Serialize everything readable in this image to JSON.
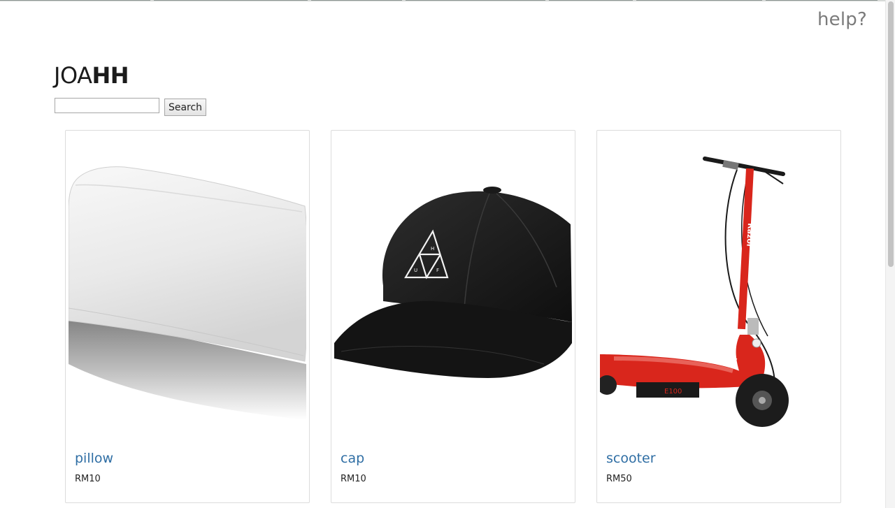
{
  "header": {
    "help_label": "help?",
    "logo": {
      "part_light": "JOA",
      "part_bold": "HH"
    }
  },
  "search": {
    "value": "",
    "placeholder": "",
    "button_label": "Search"
  },
  "products": [
    {
      "name": "pillow",
      "price": "RM10",
      "image": "pillow-image"
    },
    {
      "name": "cap",
      "price": "RM10",
      "image": "cap-image"
    },
    {
      "name": "scooter",
      "price": "RM50",
      "image": "scooter-image"
    }
  ],
  "colors": {
    "link": "#2f6ea4",
    "help": "#7b7b7b",
    "scooter_red": "#d9261c"
  }
}
